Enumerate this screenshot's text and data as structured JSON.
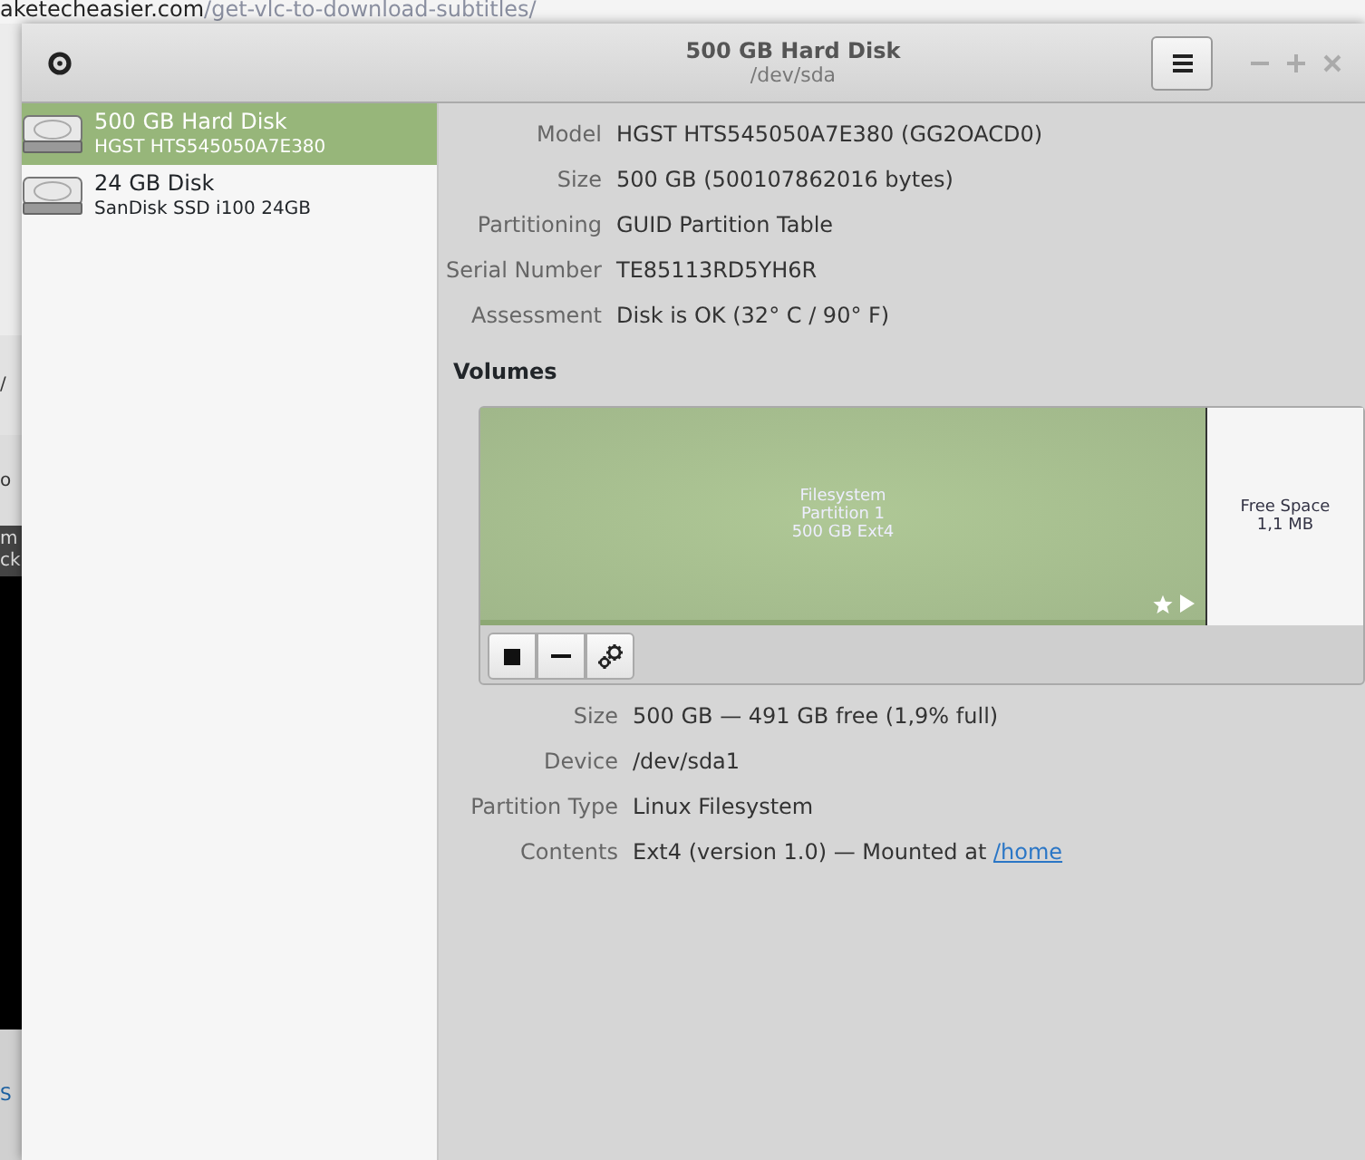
{
  "background": {
    "url_text": "aketecheasier.com/get-vlc-to-download-subtitles/",
    "fragments": [
      "/",
      "o",
      "m",
      "ck",
      "S"
    ]
  },
  "window": {
    "title": "500 GB Hard Disk",
    "subtitle": "/dev/sda"
  },
  "disks": [
    {
      "name": "500 GB Hard Disk",
      "model": "HGST HTS545050A7E380",
      "selected": true
    },
    {
      "name": "24 GB Disk",
      "model": "SanDisk SSD i100 24GB",
      "selected": false
    }
  ],
  "drive_info": [
    {
      "label": "Model",
      "value": "HGST HTS545050A7E380 (GG2OACD0)"
    },
    {
      "label": "Size",
      "value": "500 GB (500107862016 bytes)"
    },
    {
      "label": "Partitioning",
      "value": "GUID Partition Table"
    },
    {
      "label": "Serial Number",
      "value": "TE85113RD5YH6R"
    },
    {
      "label": "Assessment",
      "value": "Disk is OK (32° C / 90° F)"
    }
  ],
  "volumes": {
    "heading": "Volumes",
    "partitions": [
      {
        "kind": "filesystem",
        "lines": [
          "Filesystem",
          "Partition 1",
          "500 GB Ext4"
        ],
        "selected": true
      },
      {
        "kind": "free",
        "lines": [
          "Free Space",
          "1,1 MB"
        ],
        "selected": false
      }
    ]
  },
  "volume_info": [
    {
      "label": "Size",
      "value": "500 GB — 491 GB free (1,9% full)"
    },
    {
      "label": "Device",
      "value": "/dev/sda1"
    },
    {
      "label": "Partition Type",
      "value": "Linux Filesystem"
    },
    {
      "label": "Contents",
      "value": "Ext4 (version 1.0) — Mounted at ",
      "link": "/home"
    }
  ]
}
